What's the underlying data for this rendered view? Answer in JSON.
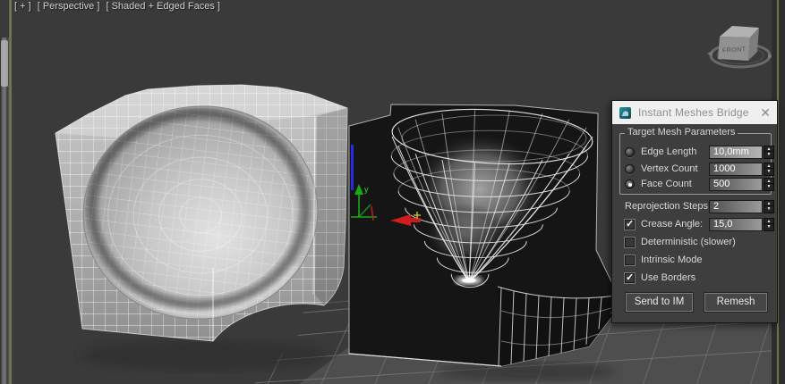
{
  "viewport": {
    "menus": {
      "general": "[ + ]",
      "pov": "[ Perspective ]",
      "shading": "[ Shaded + Edged Faces ]"
    },
    "viewcube": {
      "front": "FRONT"
    }
  },
  "dialog": {
    "title": "Instant Meshes Bridge",
    "group": "Target Mesh Parameters",
    "radios": [
      {
        "label": "Edge Length",
        "value": "10,0mm",
        "selected": false
      },
      {
        "label": "Vertex Count",
        "value": "1000",
        "selected": false
      },
      {
        "label": "Face Count",
        "value": "500",
        "selected": true
      }
    ],
    "reprojection_label": "Reprojection Steps:",
    "reprojection_value": "2",
    "crease": {
      "label": "Crease Angle:",
      "value": "15,0",
      "checked": true
    },
    "deterministic": {
      "label": "Deterministic (slower)",
      "checked": false
    },
    "intrinsic": {
      "label": "Intrinsic Mode",
      "checked": false
    },
    "use_borders": {
      "label": "Use Borders",
      "checked": true
    },
    "send_button": "Send to IM",
    "remesh_button": "Remesh"
  },
  "icons": {
    "close": "✕",
    "check": "✓",
    "spin_up": "▲",
    "spin_down": "▼"
  },
  "colors": {
    "accent_teal": "#1c7c8c",
    "gizmo_x": "#cf1d1d",
    "gizmo_y": "#18a818",
    "gizmo_z": "#2a2ae0",
    "viewport_border": "#72724a"
  }
}
